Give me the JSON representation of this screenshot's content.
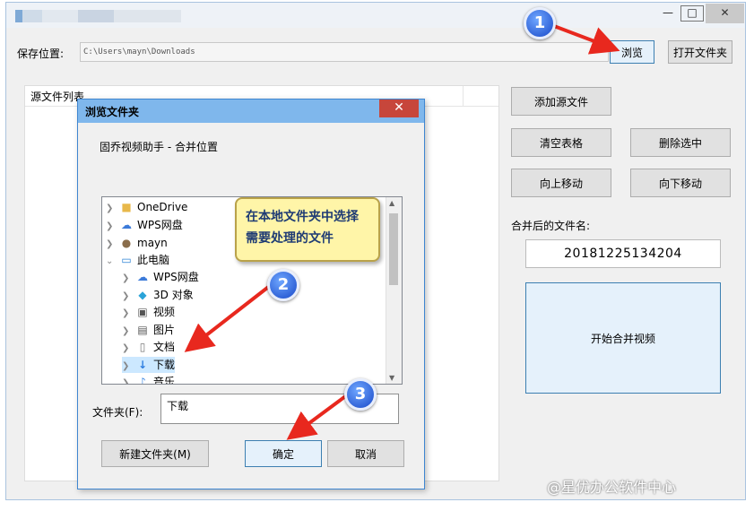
{
  "main": {
    "save_location_label": "保存位置:",
    "path_value": "C:\\Users\\mayn\\Downloads",
    "browse_button": "浏览",
    "open_folder_button": "打开文件夹",
    "source_list_header": "源文件列表",
    "add_source_button": "添加源文件",
    "clear_table_button": "清空表格",
    "delete_selected_button": "删除选中",
    "move_up_button": "向上移动",
    "move_down_button": "向下移动",
    "output_name_label": "合并后的文件名:",
    "output_name_value": "20181225134204",
    "start_merge_button": "开始合并视频",
    "window_controls": {
      "minimize": "—",
      "maximize": "□",
      "close": "✕"
    }
  },
  "dialog": {
    "title": "浏览文件夹",
    "close": "✕",
    "description": "固乔视频助手 - 合并位置",
    "tree_items": [
      {
        "label": "OneDrive",
        "icon": "folder-icon",
        "level": 0
      },
      {
        "label": "WPS网盘",
        "icon": "cloud-icon",
        "level": 0
      },
      {
        "label": "mayn",
        "icon": "user-icon",
        "level": 0
      },
      {
        "label": "此电脑",
        "icon": "computer-icon",
        "level": 0
      },
      {
        "label": "WPS网盘",
        "icon": "cloud-icon",
        "level": 1
      },
      {
        "label": "3D 对象",
        "icon": "cube-icon",
        "level": 1
      },
      {
        "label": "视频",
        "icon": "video-icon",
        "level": 1
      },
      {
        "label": "图片",
        "icon": "picture-icon",
        "level": 1
      },
      {
        "label": "文档",
        "icon": "document-icon",
        "level": 1
      },
      {
        "label": "下载",
        "icon": "download-icon",
        "level": 1
      },
      {
        "label": "音乐",
        "icon": "music-icon",
        "level": 1
      }
    ],
    "folder_label": "文件夹(F):",
    "folder_value": "下载",
    "new_folder_button": "新建文件夹(M)",
    "ok_button": "确定",
    "cancel_button": "取消"
  },
  "annotations": {
    "callout_text": "在本地文件夹中选择需要处理的文件",
    "step1": "1",
    "step2": "2",
    "step3": "3",
    "arrow_color": "#e8281e"
  },
  "watermark": "@星优办公软件中心"
}
